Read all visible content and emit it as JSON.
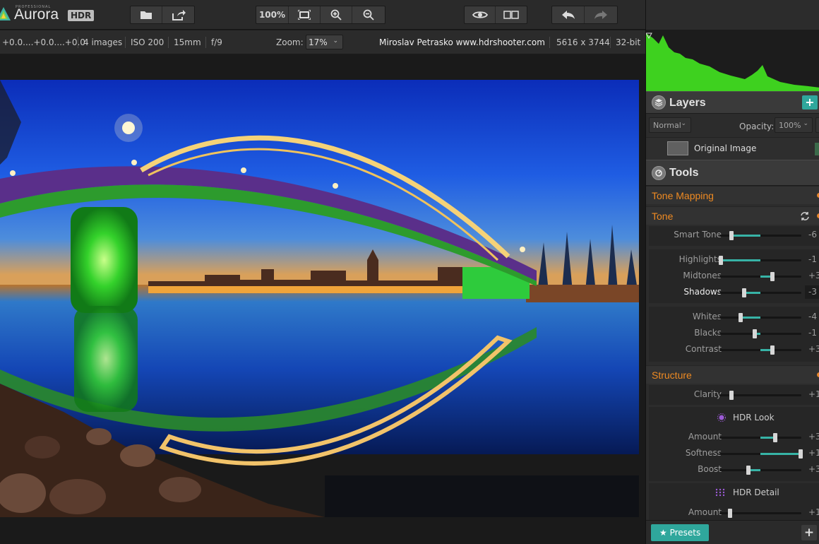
{
  "app": {
    "title_pro": "PROFESSIONAL",
    "title": "Aurora",
    "title_badge": "HDR"
  },
  "toolbar": {
    "zoom_100": "100%",
    "colors": {
      "accent": "#2fa79c",
      "orange": "#ee8a22",
      "histogram": "#3ed11f"
    }
  },
  "infobar": {
    "exposures": "+0.0....+0.0....+0.0",
    "images": "4 images",
    "iso": "ISO 200",
    "focal": "15mm",
    "aperture": "f/9",
    "zoom_label": "Zoom:",
    "zoom_value": "17%",
    "author": "Miroslav  Petrasko  www.hdrshooter.com",
    "dimensions": "5616 x 3744",
    "bitdepth": "32-bit"
  },
  "layers": {
    "title": "Layers",
    "add": "+",
    "blend_mode": "Normal",
    "opacity_label": "Opacity:",
    "opacity_value": "100%",
    "items": [
      {
        "name": "Original Image"
      }
    ]
  },
  "tools": {
    "title": "Tools",
    "tone_mapping": "Tone Mapping",
    "tone": "Tone",
    "structure": "Structure",
    "hdr_look": "HDR Look",
    "hdr_detail": "HDR Detail",
    "sliders": {
      "smart_tone": {
        "label": "Smart Tone",
        "pos": 0.15,
        "fill_from": 0.15,
        "fill_to": 0.5,
        "value": "-6"
      },
      "highlights": {
        "label": "Highlights",
        "pos": 0.02,
        "fill_from": 0.02,
        "fill_to": 0.5,
        "value": "-1"
      },
      "midtones": {
        "label": "Midtones",
        "pos": 0.65,
        "fill_from": 0.5,
        "fill_to": 0.65,
        "value": "+3"
      },
      "shadows": {
        "label": "Shadows",
        "pos": 0.3,
        "fill_from": 0.3,
        "fill_to": 0.5,
        "value": "-3"
      },
      "whites": {
        "label": "Whites",
        "pos": 0.26,
        "fill_from": 0.26,
        "fill_to": 0.5,
        "value": "-4"
      },
      "blacks": {
        "label": "Blacks",
        "pos": 0.43,
        "fill_from": 0.43,
        "fill_to": 0.5,
        "value": "-1"
      },
      "contrast": {
        "label": "Contrast",
        "pos": 0.65,
        "fill_from": 0.5,
        "fill_to": 0.65,
        "value": "+3"
      },
      "clarity": {
        "label": "Clarity",
        "pos": 0.15,
        "fill_from": 0.15,
        "fill_to": 0.15,
        "value": "+1"
      },
      "amount": {
        "label": "Amount",
        "pos": 0.68,
        "fill_from": 0.5,
        "fill_to": 0.68,
        "value": "+3"
      },
      "softness": {
        "label": "Softness",
        "pos": 0.99,
        "fill_from": 0.5,
        "fill_to": 0.99,
        "value": "+1"
      },
      "boost": {
        "label": "Boost",
        "pos": 0.35,
        "fill_from": 0.35,
        "fill_to": 0.5,
        "value": "+3"
      },
      "detail_amount": {
        "label": "Amount",
        "pos": 0.13,
        "fill_from": 0.13,
        "fill_to": 0.13,
        "value": "+1"
      }
    }
  },
  "presets": {
    "label": "★ Presets",
    "add": "+"
  }
}
